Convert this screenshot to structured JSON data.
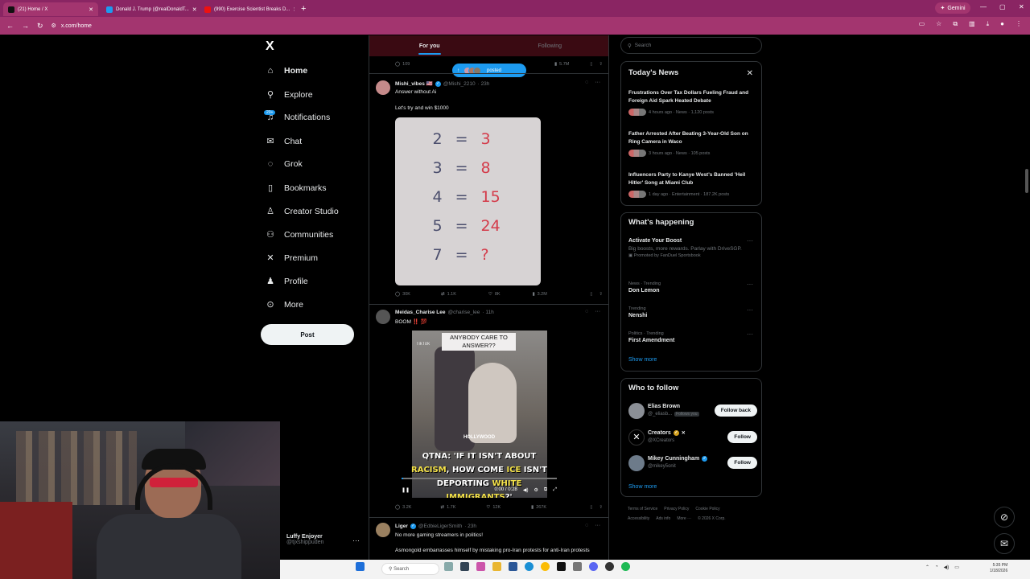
{
  "browser": {
    "tabs": [
      {
        "title": "(21) Home / X",
        "color": "#111111"
      },
      {
        "title": "Donald J. Trump (@realDonaldT...",
        "color": "#1d9bf0"
      },
      {
        "title": "(990) Exercise Scientist Breaks D...",
        "color": "#e11"
      }
    ],
    "url": "x.com/home",
    "gemini": "Gemini"
  },
  "nav": {
    "logo": "X",
    "items": [
      {
        "label": "Home",
        "icon": "home-icon",
        "glyph": "⌂"
      },
      {
        "label": "Explore",
        "icon": "search-icon",
        "glyph": "⚲"
      },
      {
        "label": "Notifications",
        "icon": "bell-icon",
        "glyph": "♫"
      },
      {
        "label": "Chat",
        "icon": "mail-icon",
        "glyph": "✉"
      },
      {
        "label": "Grok",
        "icon": "grok-icon",
        "glyph": "◌"
      },
      {
        "label": "Bookmarks",
        "icon": "bookmark-icon",
        "glyph": "▯"
      },
      {
        "label": "Creator Studio",
        "icon": "creator-icon",
        "glyph": "♙"
      },
      {
        "label": "Communities",
        "icon": "communities-icon",
        "glyph": "⚇"
      },
      {
        "label": "Premium",
        "icon": "x-icon",
        "glyph": "✕"
      },
      {
        "label": "Profile",
        "icon": "profile-icon",
        "glyph": "♟"
      },
      {
        "label": "More",
        "icon": "more-icon",
        "glyph": "⊙"
      }
    ],
    "notif_badge": "20+",
    "post_button": "Post",
    "user_name": "Luffy Enjoyer",
    "user_handle": "@tjxshippuden"
  },
  "feed": {
    "tabs": [
      "For you",
      "Following"
    ],
    "top_stats": {
      "replies": "109",
      "views": "5.7M"
    },
    "posted_pill": "posted",
    "post1": {
      "name": "Mishi_vibes 🇺🇸",
      "handle": "@Mishi_2210",
      "time": "· 23h",
      "text": "Answer without Ai",
      "text2": "Let's try and win $1000",
      "math": [
        {
          "l": "2",
          "r": "3"
        },
        {
          "l": "3",
          "r": "8"
        },
        {
          "l": "4",
          "r": "15"
        },
        {
          "l": "5",
          "r": "24"
        },
        {
          "l": "7",
          "r": "?"
        }
      ],
      "equals": "=",
      "replies": "30K",
      "reposts": "1.1K",
      "likes": "8K",
      "views": "3.2M"
    },
    "post2": {
      "name": "Meidas_Charise Lee",
      "handle": "@charise_lee",
      "time": "· 11h",
      "text": "BOOM ‼️ 💯",
      "video_top": "ANYBODY CARE TO ANSWER??",
      "video_brand": "HOLLYWOOD",
      "tiktok": "TikTok",
      "caption_a": "QTNA: 'IF IT ISN'T ABOUT ",
      "caption_b": "RACISM",
      "caption_c": ", HOW COME ",
      "caption_d": "ICE",
      "caption_e": " ISN'T DEPORTING ",
      "caption_f": "WHITE IMMIGRANTS",
      "caption_g": "?'",
      "time_display": "0:00 / 0:28",
      "replies": "3.2K",
      "reposts": "1.7K",
      "likes": "12K",
      "views": "267K"
    },
    "post3": {
      "name": "Liger",
      "handle": "@EdbieLigerSmith",
      "time": "· 23h",
      "text": "No more gaming streamers in politics!",
      "text2": "Asmongold embarrasses himself by mistaking pro-Iran protests for anti-Iran protests"
    }
  },
  "right": {
    "search_placeholder": "Search",
    "today_title": "Today's News",
    "news": [
      {
        "title": "Frustrations Over Tax Dollars Fueling Fraud and Foreign Aid Spark Heated Debate",
        "meta": "4 hours ago · News · 1,120 posts"
      },
      {
        "title": "Father Arrested After Beating 3-Year-Old Son on Ring Camera in Waco",
        "meta": "3 hours ago · News · 105 posts"
      },
      {
        "title": "Influencers Party to Kanye West's Banned 'Heil Hitler' Song at Miami Club",
        "meta": "1 day ago · Entertainment · 187.2K posts"
      }
    ],
    "happening_title": "What's happening",
    "trends": [
      {
        "category": "",
        "title": "Activate Your Boost",
        "desc": "Big boosts, more rewards. Parlay with DriveSGP.",
        "promo": "Promoted by FanDuel Sportsbook"
      },
      {
        "category": "News · Trending",
        "title": "Don Lemon",
        "desc": "",
        "promo": ""
      },
      {
        "category": "Trending",
        "title": "Nenshi",
        "desc": "",
        "promo": ""
      },
      {
        "category": "Politics · Trending",
        "title": "First Amendment",
        "desc": "",
        "promo": ""
      }
    ],
    "show_more": "Show more",
    "follow_title": "Who to follow",
    "follow": [
      {
        "name": "Elias Brown",
        "handle": "@_eliasb...",
        "tag": "Follows you",
        "button": "Follow back",
        "color": "#8b8f96"
      },
      {
        "name": "Creators",
        "handle": "@XCreators",
        "tag": "",
        "button": "Follow",
        "color": "#000000"
      },
      {
        "name": "Mikey Cunningham",
        "handle": "@mikey5onit",
        "tag": "",
        "button": "Follow",
        "color": "#6d7b8a"
      }
    ],
    "footer1": [
      "Terms of Service",
      "Privacy Policy",
      "Cookie Policy"
    ],
    "footer2": [
      "Accessibility",
      "Ads info",
      "More ···",
      "© 2026 X Corp."
    ]
  },
  "taskbar": {
    "search": "Search",
    "time": "5:35 PM",
    "date": "1/18/2026"
  }
}
